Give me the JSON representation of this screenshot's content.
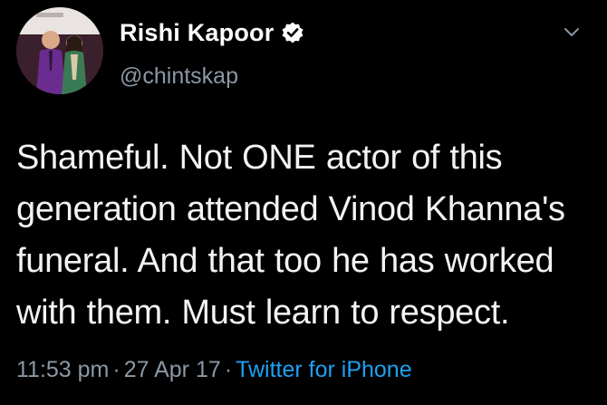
{
  "author": {
    "display_name": "Rishi Kapoor",
    "handle": "@chintskap",
    "verified": true,
    "avatar_icon": "profile-photo"
  },
  "tweet": {
    "text": "Shameful. Not ONE actor of this generation attended Vinod Khanna's funeral. And that too he has worked with them. Must learn to respect.",
    "time": "11:53 pm",
    "date": "27 Apr 17",
    "separator": "·",
    "source": "Twitter for iPhone"
  },
  "colors": {
    "background": "#000000",
    "text": "#f1f3f4",
    "muted": "#8b98a5",
    "link": "#1da1f2"
  },
  "icons": {
    "verified": "verified-badge-icon",
    "menu": "chevron-down-icon"
  }
}
